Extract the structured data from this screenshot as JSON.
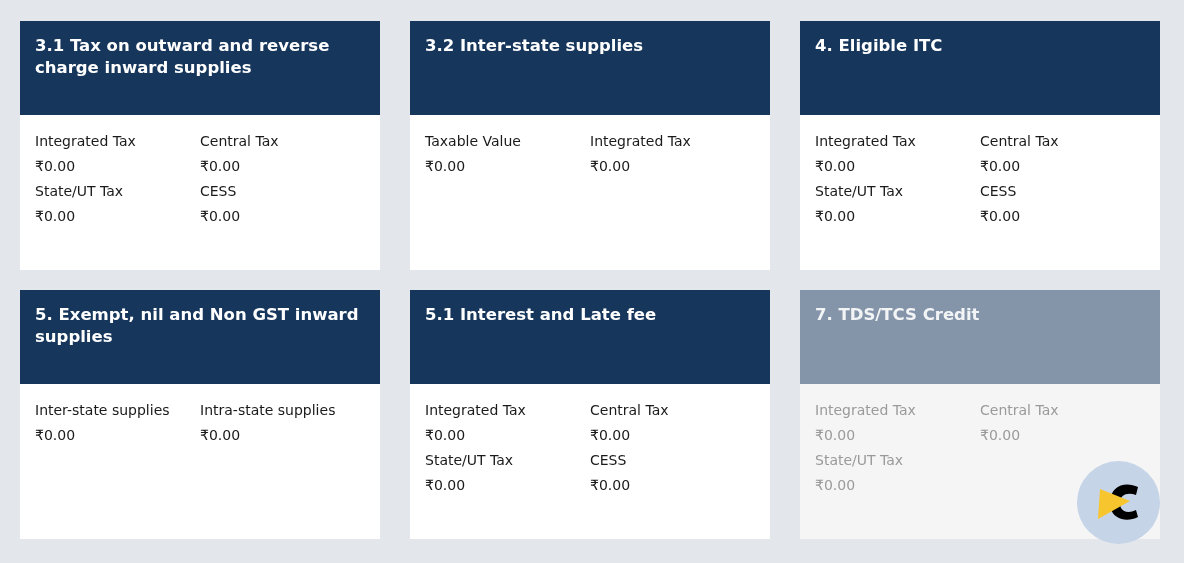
{
  "cards": [
    {
      "title": "3.1 Tax on outward and reverse charge inward supplies",
      "disabled": false,
      "fields": [
        {
          "label": "Integrated Tax",
          "value": "₹0.00"
        },
        {
          "label": "Central Tax",
          "value": "₹0.00"
        },
        {
          "label": "State/UT Tax",
          "value": "₹0.00"
        },
        {
          "label": "CESS",
          "value": "₹0.00"
        }
      ]
    },
    {
      "title": "3.2 Inter-state supplies",
      "disabled": false,
      "fields": [
        {
          "label": "Taxable Value",
          "value": "₹0.00"
        },
        {
          "label": "Integrated Tax",
          "value": "₹0.00"
        }
      ]
    },
    {
      "title": "4. Eligible ITC",
      "disabled": false,
      "fields": [
        {
          "label": "Integrated Tax",
          "value": "₹0.00"
        },
        {
          "label": "Central Tax",
          "value": "₹0.00"
        },
        {
          "label": "State/UT Tax",
          "value": "₹0.00"
        },
        {
          "label": "CESS",
          "value": "₹0.00"
        }
      ]
    },
    {
      "title": "5. Exempt, nil and Non GST inward supplies",
      "disabled": false,
      "fields": [
        {
          "label": "Inter-state supplies",
          "value": "₹0.00"
        },
        {
          "label": "Intra-state supplies",
          "value": "₹0.00"
        }
      ]
    },
    {
      "title": "5.1 Interest and Late fee",
      "disabled": false,
      "fields": [
        {
          "label": "Integrated Tax",
          "value": "₹0.00"
        },
        {
          "label": "Central Tax",
          "value": "₹0.00"
        },
        {
          "label": "State/UT Tax",
          "value": "₹0.00"
        },
        {
          "label": "CESS",
          "value": "₹0.00"
        }
      ]
    },
    {
      "title": "7. TDS/TCS Credit",
      "disabled": true,
      "fields": [
        {
          "label": "Integrated Tax",
          "value": "₹0.00"
        },
        {
          "label": "Central Tax",
          "value": "₹0.00"
        },
        {
          "label": "State/UT Tax",
          "value": "₹0.00"
        }
      ]
    }
  ]
}
